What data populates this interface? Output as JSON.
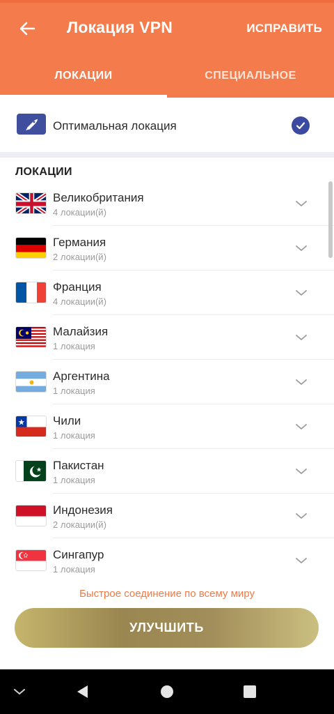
{
  "header": {
    "title": "Локация VPN",
    "action_label": "ИСПРАВИТЬ",
    "background_color": "#f47b4b"
  },
  "tabs": [
    {
      "label": "ЛОКАЦИИ",
      "active": true
    },
    {
      "label": "СПЕЦИАЛЬНОЕ",
      "active": false
    }
  ],
  "optimal": {
    "label": "Оптимальная локация",
    "selected": true,
    "icon": "rocket-icon"
  },
  "section_title": "ЛОКАЦИИ",
  "locations": [
    {
      "name": "Великобритания",
      "count": "4 локации(й)",
      "flag": "flag-uk-icon"
    },
    {
      "name": "Германия",
      "count": "2 локации(й)",
      "flag": "flag-de-icon"
    },
    {
      "name": "Франция",
      "count": "4 локации(й)",
      "flag": "flag-fr-icon"
    },
    {
      "name": "Малайзия",
      "count": "1 локация",
      "flag": "flag-my-icon"
    },
    {
      "name": "Аргентина",
      "count": "1 локация",
      "flag": "flag-ar-icon"
    },
    {
      "name": "Чили",
      "count": "1 локация",
      "flag": "flag-cl-icon"
    },
    {
      "name": "Пакистан",
      "count": "1 локация",
      "flag": "flag-pk-icon"
    },
    {
      "name": "Индонезия",
      "count": "2 локации(й)",
      "flag": "flag-id-icon"
    },
    {
      "name": "Сингапур",
      "count": "1 локация",
      "flag": "flag-sg-icon"
    }
  ],
  "promo_text": "Быстрое соединение по всему миру",
  "upgrade_label": "УЛУЧШИТЬ",
  "colors": {
    "accent": "#f47b4b",
    "check": "#3b4aa0",
    "gold": "#a28e5a"
  }
}
